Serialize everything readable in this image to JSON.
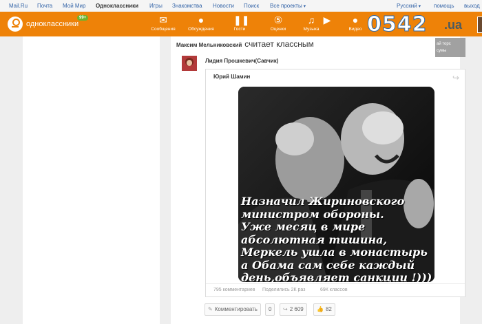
{
  "portal": {
    "links": [
      "Mail.Ru",
      "Почта",
      "Мой Мир",
      "Одноклассники",
      "Игры",
      "Знакомства",
      "Новости",
      "Поиск",
      "Все проекты"
    ],
    "active_index": 3,
    "language": "Русский",
    "help": "помощь",
    "logout": "выход"
  },
  "header": {
    "logo_text": "одноклассники",
    "badge": "99+",
    "nav": [
      {
        "label": "Сообщения",
        "icon": "envelope-icon"
      },
      {
        "label": "Обсуждения",
        "icon": "speech-bubbles-icon"
      },
      {
        "label": "Гости",
        "icon": "footprints-icon"
      },
      {
        "label": "Оценки",
        "icon": "five-star-icon"
      },
      {
        "label": "Музыка",
        "icon": "music-note-icon"
      },
      {
        "label": "Видео",
        "icon": "camera-icon"
      }
    ],
    "accent_color": "#ee8208"
  },
  "watermark": {
    "logo": "0542",
    "suffix": ".ua"
  },
  "feed": {
    "actor": "Максим Мельниковский",
    "action": "считает классным",
    "overlay_text": "ай торс сумы"
  },
  "post": {
    "reposter": "Лидия Прошкевич(Савчик)",
    "author": "Юрий Шамин",
    "image_text": [
      "Назначил Жириновского",
      "министром обороны.",
      "Уже месяц в мире",
      "абсолютная тишина,",
      "Меркель ушла в монастырь",
      "а Обама сам себе каждый",
      "день,объявляет санкции !)))"
    ],
    "stats": {
      "comments": "795 комментариев",
      "shared": "Поделились 2К раз",
      "likes": "69К классов"
    },
    "actions": {
      "comment_label": "Комментировать",
      "comment_count": "0",
      "share_count": "2 609",
      "class_count": "82"
    }
  }
}
